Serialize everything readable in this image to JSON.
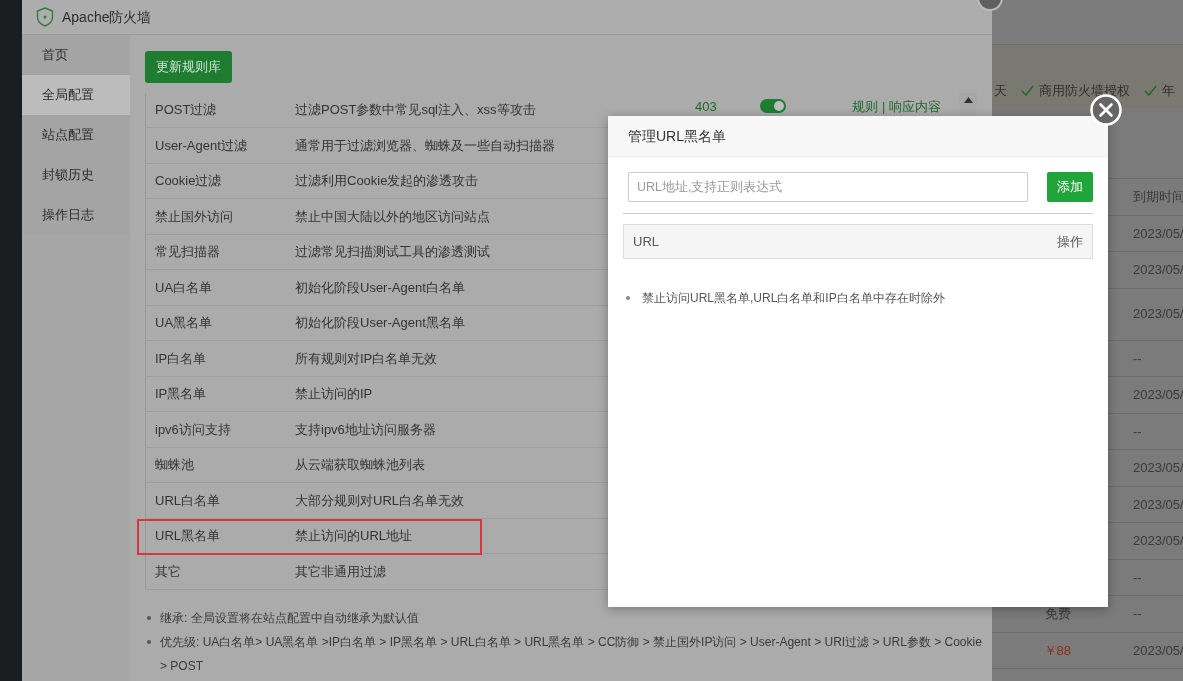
{
  "window": {
    "title": "Apache防火墙"
  },
  "sidebar": {
    "items": [
      {
        "label": "首页",
        "selected": false
      },
      {
        "label": "全局配置",
        "selected": true
      },
      {
        "label": "站点配置",
        "selected": false
      },
      {
        "label": "封锁历史",
        "selected": false
      },
      {
        "label": "操作日志",
        "selected": false
      }
    ]
  },
  "update_button": "更新规则库",
  "rules": [
    {
      "name": "POST过滤",
      "description": "过滤POST参数中常见sql注入、xss等攻击",
      "code": "403",
      "enabled": true,
      "links": [
        "规则",
        "响应内容"
      ],
      "link_separator": "|",
      "highlighted": false
    },
    {
      "name": "User-Agent过滤",
      "description": "通常用于过滤浏览器、蜘蛛及一些自动扫描器",
      "highlighted": false
    },
    {
      "name": "Cookie过滤",
      "description": "过滤利用Cookie发起的渗透攻击",
      "highlighted": false
    },
    {
      "name": "禁止国外访问",
      "description": "禁止中国大陆以外的地区访问站点",
      "highlighted": false
    },
    {
      "name": "常见扫描器",
      "description": "过滤常见扫描测试工具的渗透测试",
      "highlighted": false
    },
    {
      "name": "UA白名单",
      "description": "初始化阶段User-Agent白名单",
      "highlighted": false
    },
    {
      "name": "UA黑名单",
      "description": "初始化阶段User-Agent黑名单",
      "highlighted": false
    },
    {
      "name": "IP白名单",
      "description": "所有规则对IP白名单无效",
      "highlighted": false
    },
    {
      "name": "IP黑名单",
      "description": "禁止访问的IP",
      "highlighted": false
    },
    {
      "name": "ipv6访问支持",
      "description": "支持ipv6地址访问服务器",
      "highlighted": false
    },
    {
      "name": "蜘蛛池",
      "description": "从云端获取蜘蛛池列表",
      "highlighted": false
    },
    {
      "name": "URL白名单",
      "description": "大部分规则对URL白名单无效",
      "highlighted": false
    },
    {
      "name": "URL黑名单",
      "description": "禁止访问的URL地址",
      "highlighted": true
    },
    {
      "name": "其它",
      "description": "其它非通用过滤",
      "highlighted": false
    }
  ],
  "notes": [
    "继承: 全局设置将在站点配置中自动继承为默认值",
    "优先级: UA白名单> UA黑名单 >IP白名单 > IP黑名单 > URL白名单 > URL黑名单 > CC防御 > 禁止国外IP访问 > User-Agent > URI过滤 > URL参数 > Cookie > POST"
  ],
  "background_page": {
    "features": [
      {
        "text": "天",
        "checked": false
      },
      {
        "text": "商用防火墙授权",
        "checked": true
      },
      {
        "text": "年",
        "checked": true
      }
    ],
    "column_header": "到期时间",
    "rows": [
      {
        "expiry": "2023/05/"
      },
      {
        "expiry": "2023/05/"
      },
      {
        "expiry": "2023/05/",
        "tall": true
      },
      {
        "expiry": "--"
      },
      {
        "expiry": "2023/05/"
      },
      {
        "expiry": "--"
      },
      {
        "expiry": "2023/05/"
      },
      {
        "expiry": "2023/05/"
      },
      {
        "expiry": "2023/05/"
      },
      {
        "expiry": "--"
      },
      {
        "price": "免费",
        "expiry": "--"
      },
      {
        "price": "￥88",
        "color": "#8a2f22",
        "expiry": "2023/05/"
      }
    ]
  },
  "modal": {
    "title": "管理URL黑名单",
    "input": {
      "placeholder": "URL地址,支持正则表达式"
    },
    "add_button": "添加",
    "columns": [
      "URL",
      "操作"
    ],
    "notes": [
      "禁止访问URL黑名单,URL白名单和IP白名单中存在时除外"
    ]
  }
}
